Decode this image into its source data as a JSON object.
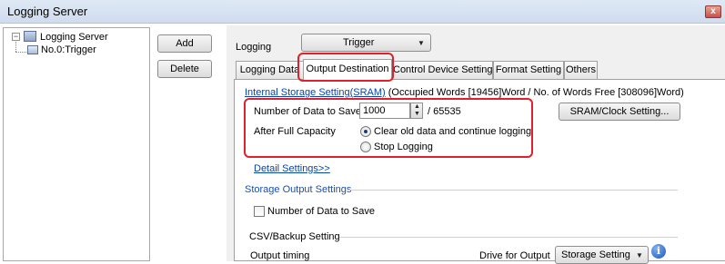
{
  "window": {
    "title": "Logging Server",
    "close_glyph": "x"
  },
  "tree": {
    "root_label": "Logging Server",
    "root_expander": "−",
    "root_icon": "logging-server-icon",
    "child_label": "No.0:Trigger",
    "child_icon": "trigger-icon"
  },
  "buttons": {
    "add": "Add",
    "delete": "Delete"
  },
  "logging": {
    "label": "Logging",
    "mode_value": "Trigger"
  },
  "tabs": [
    {
      "label": "Logging Data"
    },
    {
      "label": "Output Destination"
    },
    {
      "label": "Control Device Setting"
    },
    {
      "label": "Format Setting"
    },
    {
      "label": "Others"
    }
  ],
  "active_tab": "Output Destination",
  "sram": {
    "link_text": "Internal Storage Setting(SRAM)",
    "info_text": " (Occupied Words [19456]Word / No. of Words Free [308096]Word)",
    "data_to_save_label": "Number of Data to Save",
    "data_to_save_value": "1000",
    "max_value": "/ 65535",
    "after_full_label": "After Full Capacity",
    "radio_clear": "Clear old data and continue logging",
    "radio_stop": "Stop Logging",
    "selected": "clear",
    "clock_button": "SRAM/Clock Setting..."
  },
  "detail_settings": "Detail Settings>>",
  "storage": {
    "title": "Storage Output Settings",
    "checkbox_label": "Number of Data to Save",
    "checkbox_checked": false,
    "csv_title": "CSV/Backup Setting",
    "output_timing": "Output timing",
    "drive_label": "Drive for Output",
    "drive_value": "Storage Setting"
  },
  "colors": {
    "highlight": "#e0202a",
    "link": "#0645ad",
    "section": "#1b4fb3"
  }
}
